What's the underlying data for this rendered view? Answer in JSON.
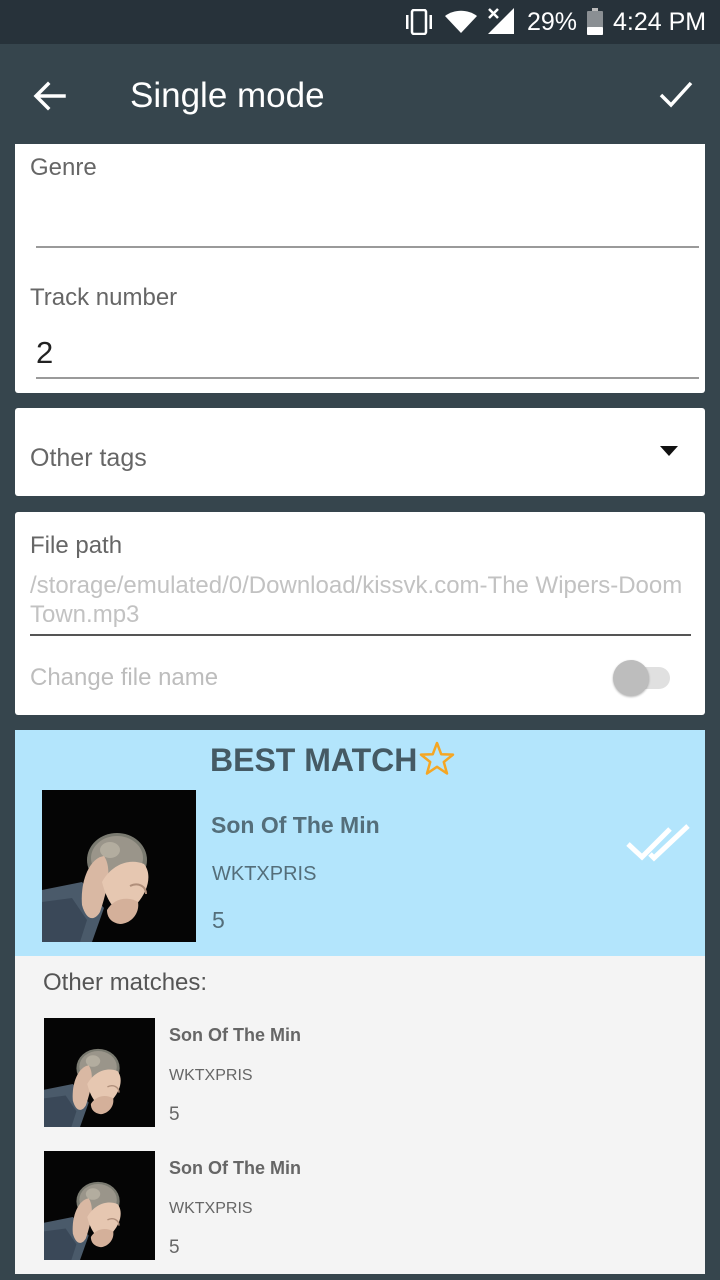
{
  "status_bar": {
    "battery_percent": "29%",
    "time": "4:24 PM"
  },
  "app_bar": {
    "title": "Single mode",
    "back_icon": "arrow-back-icon",
    "confirm_icon": "check-icon"
  },
  "form": {
    "genre": {
      "label": "Genre",
      "value": ""
    },
    "track_number": {
      "label": "Track number",
      "value": "2"
    }
  },
  "other_tags": {
    "label": "Other tags",
    "icon": "dropdown-caret-icon"
  },
  "file": {
    "label": "File path",
    "path": "/storage/emulated/0/Download/kissvk.com-The Wipers-Doom Town.mp3",
    "change_name_label": "Change file name",
    "change_name_enabled": false
  },
  "best_match": {
    "heading": "BEST MATCH",
    "title": "Son Of The Min",
    "artist": "WKTXPRIS",
    "number": "5",
    "colors": {
      "background": "#b3e5fc",
      "star": "#f5a623"
    }
  },
  "other_matches": {
    "heading": "Other matches:",
    "items": [
      {
        "title": "Son Of The Min",
        "artist": "WKTXPRIS",
        "number": "5"
      },
      {
        "title": "Son Of The Min",
        "artist": "WKTXPRIS",
        "number": "5"
      }
    ]
  }
}
